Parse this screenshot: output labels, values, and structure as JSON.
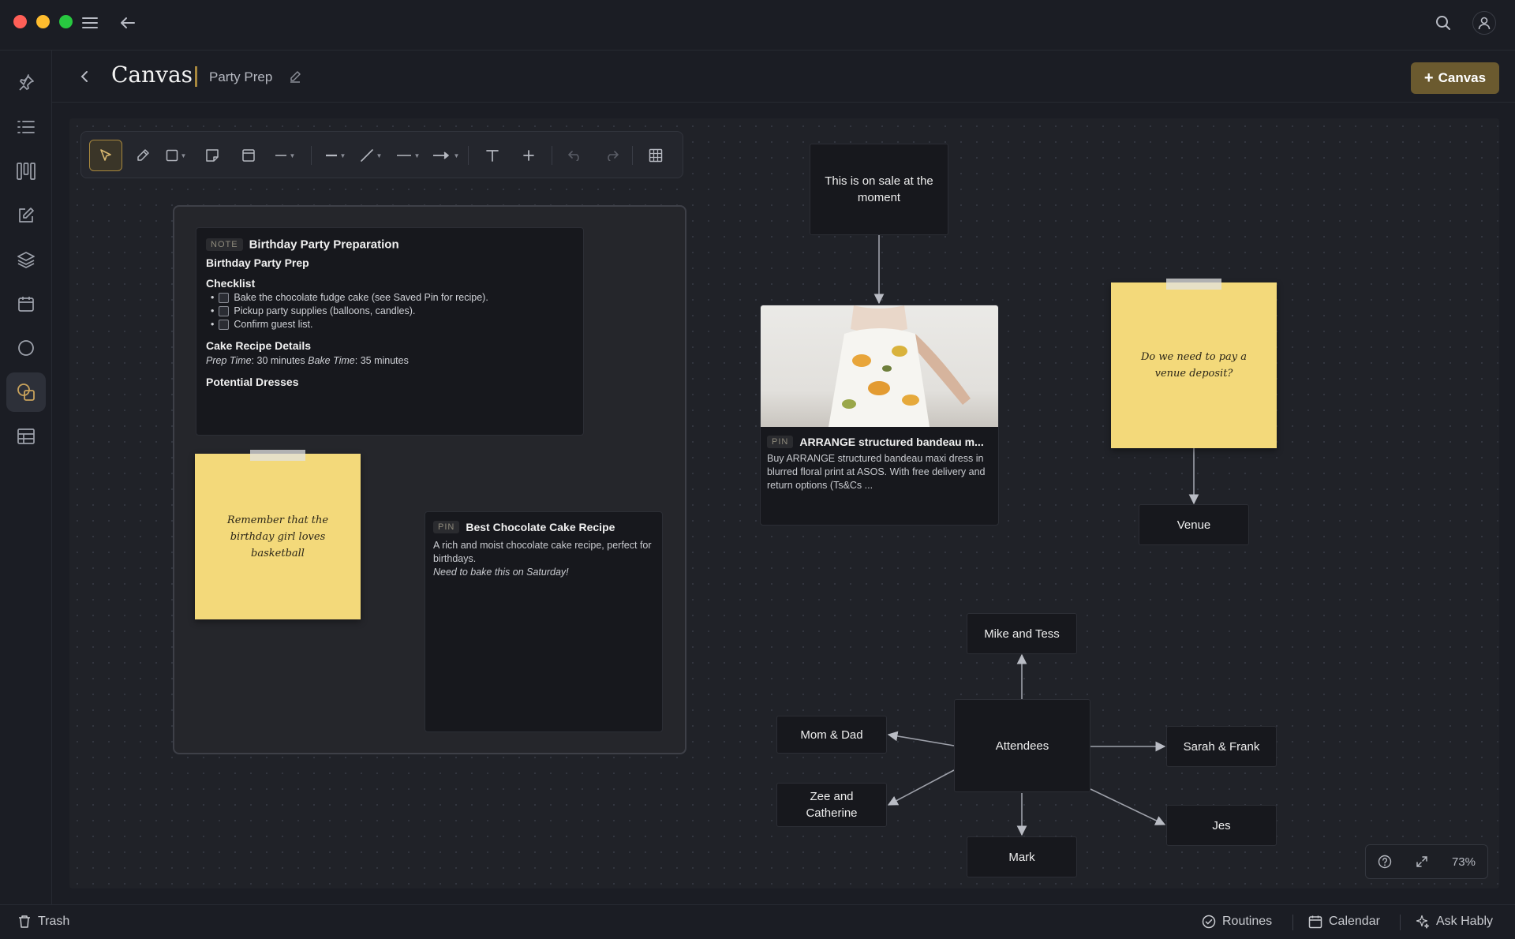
{
  "window": {
    "traffic_lights": [
      "#ff5f57",
      "#febc2e",
      "#28c840"
    ]
  },
  "header": {
    "title": "Canvas",
    "subtitle": "Party Prep",
    "add_button_label": "Canvas"
  },
  "sidebar": {
    "items": [
      "pin-icon",
      "list-icon",
      "board-icon",
      "edit-icon",
      "layers-icon",
      "calendar-icon",
      "circle-icon",
      "canvas-icon",
      "table-icon"
    ],
    "active": "canvas-icon"
  },
  "toolbar": {
    "tools": [
      "select-tool",
      "pen-tool",
      "shape-tool",
      "sticky-tool",
      "frame-tool",
      "line-style-tool",
      "stroke-tool",
      "connector-tool",
      "dash-tool",
      "arrow-tool",
      "text-tool",
      "add-tool",
      "undo",
      "redo",
      "grid-toggle"
    ]
  },
  "note_card": {
    "tag": "NOTE",
    "title": "Birthday Party Preparation",
    "heading": "Birthday Party Prep",
    "checklist_heading": "Checklist",
    "checklist": [
      "Bake the chocolate fudge cake (see Saved Pin for recipe).",
      "Pickup party supplies (balloons, candles).",
      "Confirm guest list."
    ],
    "recipe_heading": "Cake Recipe Details",
    "prep_label": "Prep Time",
    "prep_value": ": 30 minutes ",
    "bake_label": "Bake Time",
    "bake_value": ": 35 minutes",
    "dresses_heading": "Potential Dresses"
  },
  "sticky_basketball": {
    "text": "Remember that the birthday girl loves basketball"
  },
  "sticky_venue": {
    "text": "Do we need to pay a venue deposit?"
  },
  "pin_cake": {
    "tag": "PIN",
    "title": "Best Chocolate Cake Recipe",
    "desc": "A rich and moist chocolate cake recipe, perfect for birthdays.",
    "note": "Need to bake this on Saturday!"
  },
  "pin_dress": {
    "tag": "PIN",
    "title": "ARRANGE structured bandeau m...",
    "desc": "Buy ARRANGE structured bandeau maxi dress in blurred floral print at ASOS. With free delivery and return options (Ts&Cs ..."
  },
  "sale_note": {
    "text": "This is on sale at the moment"
  },
  "venue": {
    "text": "Venue"
  },
  "attendees": {
    "center": "Attendees",
    "mike": "Mike and Tess",
    "mom": "Mom & Dad",
    "zee": "Zee and Catherine",
    "mark": "Mark",
    "sarah": "Sarah & Frank",
    "jes": "Jes"
  },
  "zoom": {
    "level": "73%"
  },
  "statusbar": {
    "trash": "Trash",
    "routines": "Routines",
    "calendar": "Calendar",
    "ask": "Ask Hably"
  },
  "colors": {
    "accent": "#c9a35c",
    "sticky": "#f3d97a",
    "button": "#6b5a2f"
  }
}
